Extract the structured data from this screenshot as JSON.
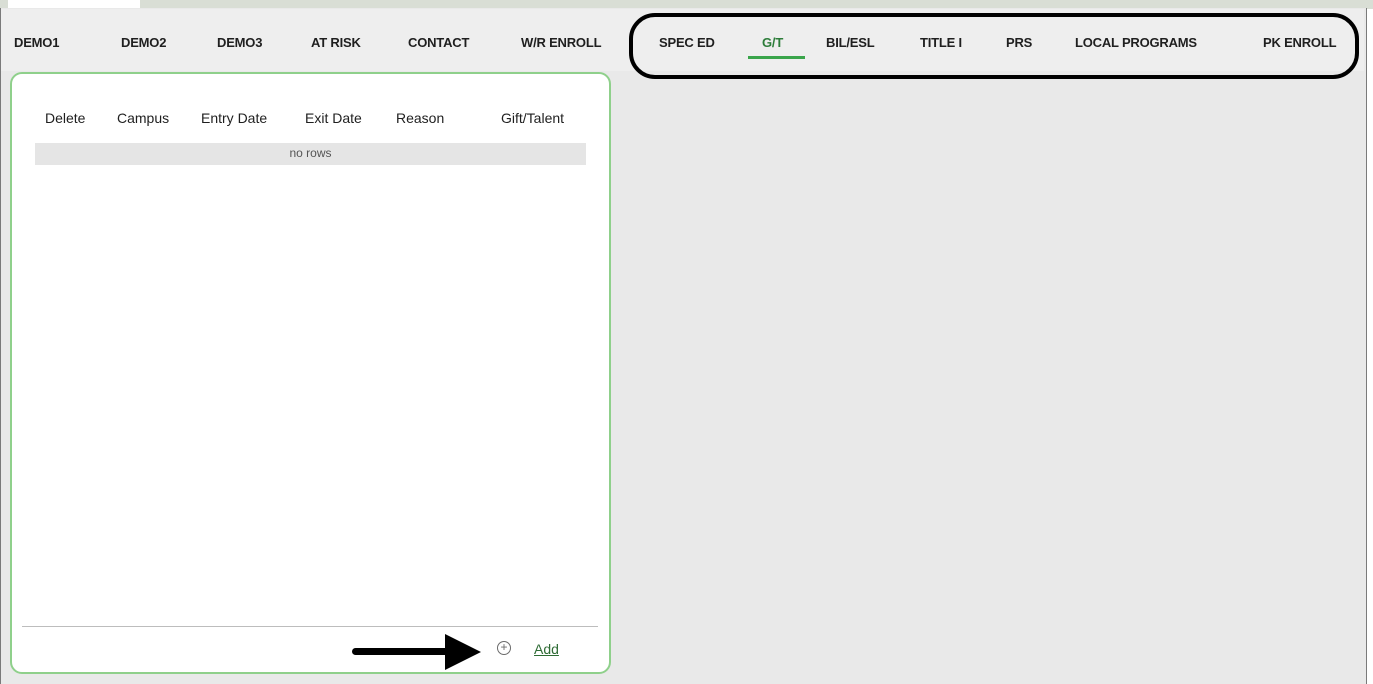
{
  "tabs": [
    {
      "label": "DEMO1"
    },
    {
      "label": "DEMO2"
    },
    {
      "label": "DEMO3"
    },
    {
      "label": "AT RISK"
    },
    {
      "label": "CONTACT"
    },
    {
      "label": "W/R ENROLL"
    },
    {
      "label": "SPEC ED"
    },
    {
      "label": "G/T",
      "active": true
    },
    {
      "label": "BIL/ESL"
    },
    {
      "label": "TITLE I"
    },
    {
      "label": "PRS"
    },
    {
      "label": "LOCAL PROGRAMS"
    },
    {
      "label": "PK ENROLL"
    }
  ],
  "table": {
    "columns": [
      "Delete",
      "Campus",
      "Entry Date",
      "Exit Date",
      "Reason",
      "Gift/Talent"
    ],
    "empty_text": "no rows"
  },
  "footer": {
    "add_icon": "plus-circle-icon",
    "add_label": "Add"
  },
  "colors": {
    "active_tab": "#2d7d3a",
    "active_underline": "#3aa54b",
    "panel_border": "#8fd08b"
  }
}
